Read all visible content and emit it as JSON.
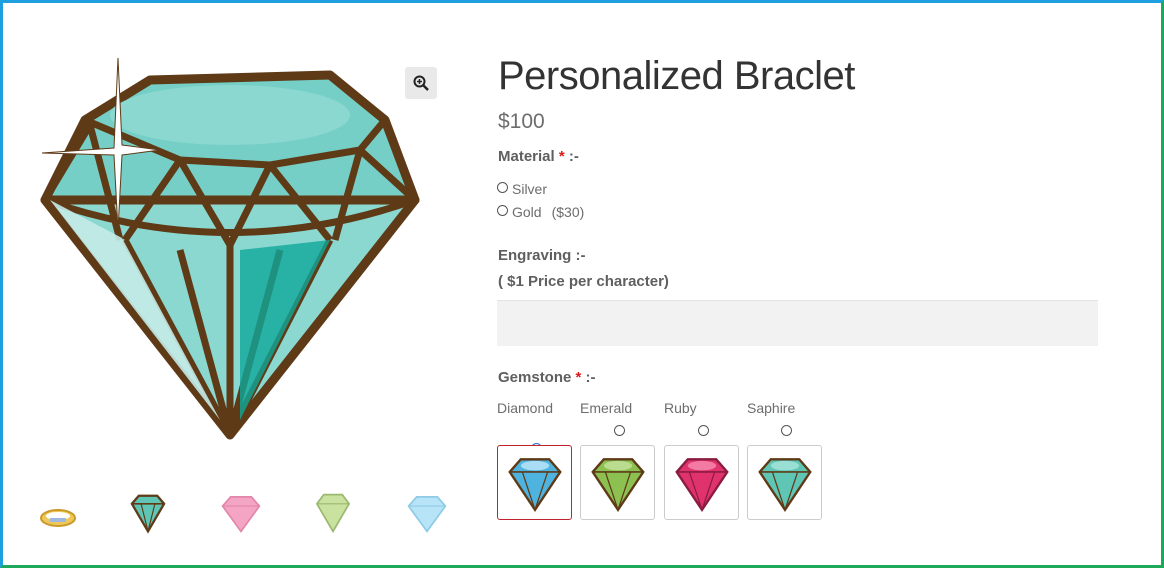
{
  "product": {
    "title": "Personalized Braclet",
    "price": "$100"
  },
  "zoom": {
    "icon": "zoom-in-icon"
  },
  "gallery": {
    "thumbnails": [
      {
        "icon": "ring-thumbnail"
      },
      {
        "icon": "teal-diamond-thumbnail"
      },
      {
        "icon": "pink-diamond-thumbnail"
      },
      {
        "icon": "green-diamond-thumbnail"
      },
      {
        "icon": "blue-diamond-thumbnail"
      }
    ]
  },
  "material": {
    "label": "Material",
    "required_mark": "*",
    "suffix": ":-",
    "options": [
      {
        "label": "Silver",
        "extra": ""
      },
      {
        "label": "Gold",
        "extra": "($30)"
      }
    ]
  },
  "engraving": {
    "label": "Engraving :-",
    "note": "( $1 Price per character)",
    "value": ""
  },
  "gemstone": {
    "label": "Gemstone",
    "required_mark": "*",
    "suffix": ":-",
    "selected": "Diamond",
    "options": [
      {
        "label": "Diamond",
        "color": "#4fb3e0"
      },
      {
        "label": "Emerald",
        "color": "#8cc152"
      },
      {
        "label": "Ruby",
        "color": "#e0336e"
      },
      {
        "label": "Saphire",
        "color": "#5fc6b6"
      }
    ]
  },
  "colors": {
    "diamond_main": "#76cfc6",
    "diamond_outline": "#5e3a17",
    "frame_left": "#1e9fe0",
    "frame_right": "#1ea85a",
    "selected_border": "#c0232c",
    "required": "#e01616"
  }
}
